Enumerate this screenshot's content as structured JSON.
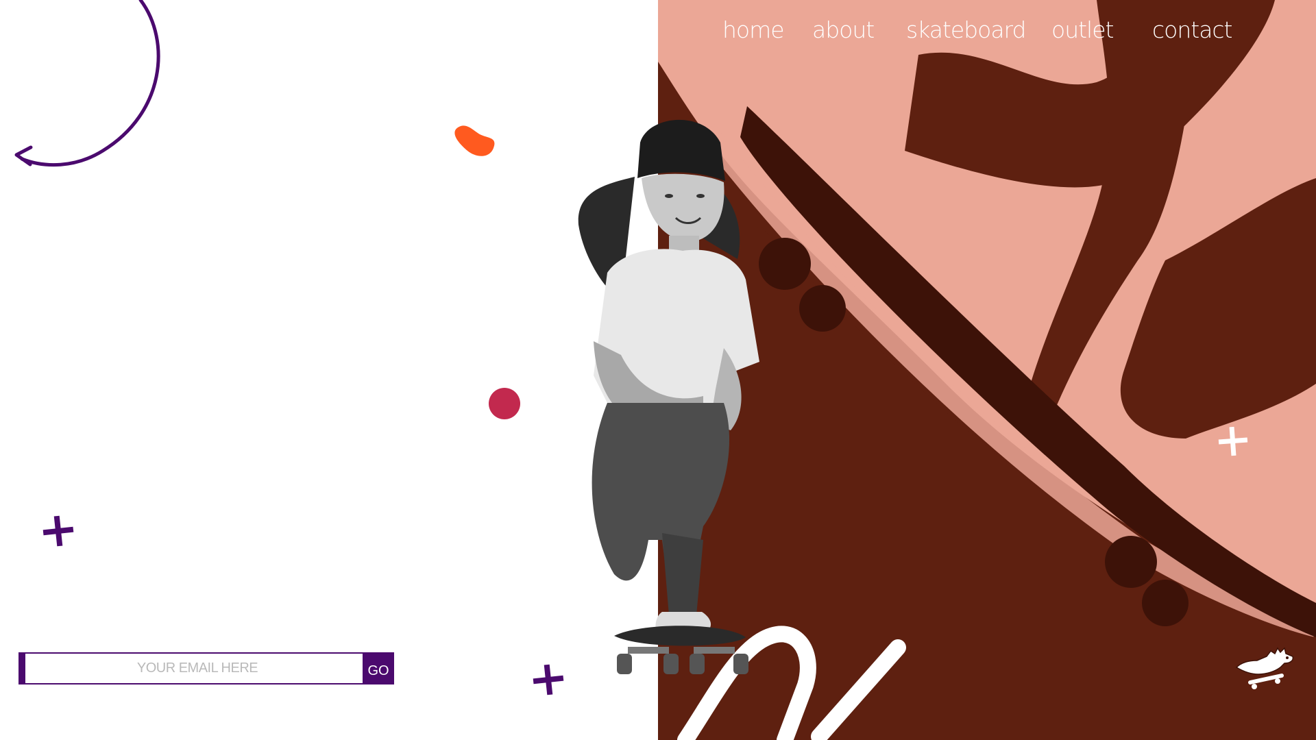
{
  "nav": {
    "items": [
      {
        "label": "home"
      },
      {
        "label": "about"
      },
      {
        "label": "skateboard"
      },
      {
        "label": "outlet"
      },
      {
        "label": "contact"
      }
    ]
  },
  "newsletter": {
    "placeholder": "YOUR EMAIL HERE",
    "button_label": "GO"
  },
  "colors": {
    "brand_purple": "#4b0a6e",
    "hero_dark": "#5e2010",
    "hero_light": "#eba796",
    "accent_orange": "#ff5a1f",
    "accent_crimson": "#c2294e",
    "white": "#ffffff"
  },
  "icons": {
    "curved_arrow": "curved-arrow-icon",
    "plus": "plus-icon",
    "logo": "dinosaur-skateboard-logo"
  }
}
